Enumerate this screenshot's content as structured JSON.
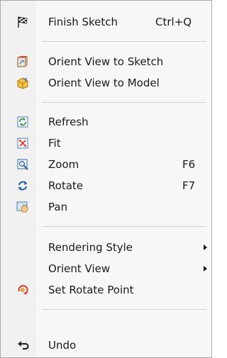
{
  "menu": {
    "items": {
      "finish_sketch": {
        "label": "Finish Sketch",
        "shortcut": "Ctrl+Q",
        "icon": "checkered-flag-icon"
      },
      "orient_view_to_sketch": {
        "label": "Orient View to Sketch",
        "icon": "orient-to-sketch-icon"
      },
      "orient_view_to_model": {
        "label": "Orient View to Model",
        "icon": "orient-to-model-icon"
      },
      "refresh": {
        "label": "Refresh",
        "icon": "refresh-icon"
      },
      "fit": {
        "label": "Fit",
        "icon": "fit-icon"
      },
      "zoom": {
        "label": "Zoom",
        "shortcut": "F6",
        "icon": "zoom-icon"
      },
      "rotate": {
        "label": "Rotate",
        "shortcut": "F7",
        "icon": "rotate-icon"
      },
      "pan": {
        "label": "Pan",
        "icon": "pan-hand-icon"
      },
      "rendering_style": {
        "label": "Rendering Style",
        "has_submenu": true
      },
      "orient_view": {
        "label": "Orient View",
        "has_submenu": true
      },
      "set_rotate_point": {
        "label": "Set Rotate Point",
        "icon": "rotate-point-icon"
      },
      "undo": {
        "label": "Undo",
        "icon": "undo-arrow-icon"
      }
    }
  },
  "colors": {
    "menu_background": "#f7f7f7",
    "border": "#a7abb0",
    "separator": "#cfd2d6",
    "text": "#1a1a1a"
  }
}
